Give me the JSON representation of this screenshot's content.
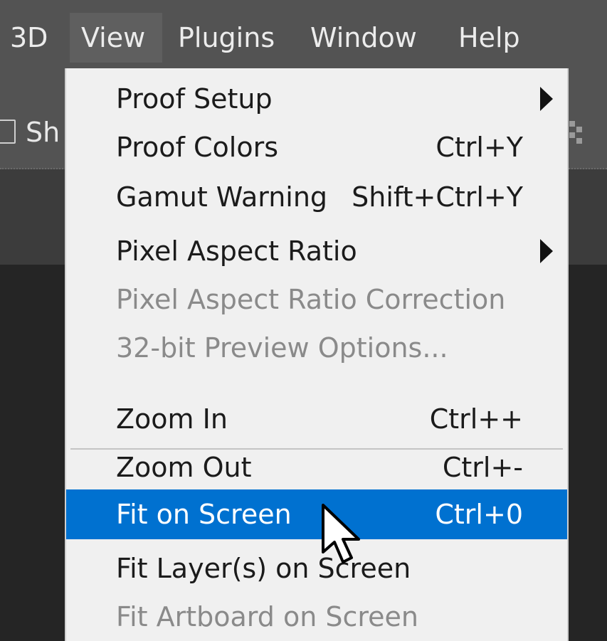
{
  "menubar": {
    "items": [
      {
        "label": "3D"
      },
      {
        "label": "View"
      },
      {
        "label": "Plugins"
      },
      {
        "label": "Window"
      },
      {
        "label": "Help"
      }
    ]
  },
  "options_bar": {
    "partial_label": "Sh"
  },
  "view_menu": {
    "group1": [
      {
        "label": "Proof Setup",
        "shortcut": "",
        "submenu": true,
        "enabled": true
      },
      {
        "label": "Proof Colors",
        "shortcut": "Ctrl+Y",
        "submenu": false,
        "enabled": true
      },
      {
        "label": "Gamut Warning",
        "shortcut": "Shift+Ctrl+Y",
        "submenu": false,
        "enabled": true
      },
      {
        "label": "Pixel Aspect Ratio",
        "shortcut": "",
        "submenu": true,
        "enabled": true
      },
      {
        "label": "Pixel Aspect Ratio Correction",
        "shortcut": "",
        "submenu": false,
        "enabled": false
      },
      {
        "label": "32-bit Preview Options...",
        "shortcut": "",
        "submenu": false,
        "enabled": false
      }
    ],
    "group2": [
      {
        "label": "Zoom In",
        "shortcut": "Ctrl++",
        "enabled": true,
        "highlighted": false
      },
      {
        "label": "Zoom Out",
        "shortcut": "Ctrl+-",
        "enabled": true,
        "highlighted": false
      },
      {
        "label": "Fit on Screen",
        "shortcut": "Ctrl+0",
        "enabled": true,
        "highlighted": true
      },
      {
        "label": "Fit Layer(s) on Screen",
        "shortcut": "",
        "enabled": true,
        "highlighted": false
      },
      {
        "label": "Fit Artboard on Screen",
        "shortcut": "",
        "enabled": false,
        "highlighted": false
      }
    ]
  },
  "colors": {
    "menubar_bg": "#535353",
    "menu_bg": "#f0f0f0",
    "highlight": "#0071d0",
    "disabled_text": "#8a8a8a"
  },
  "icons": {
    "submenu": "chevron-right-icon",
    "cursor": "arrow-cursor-icon"
  }
}
